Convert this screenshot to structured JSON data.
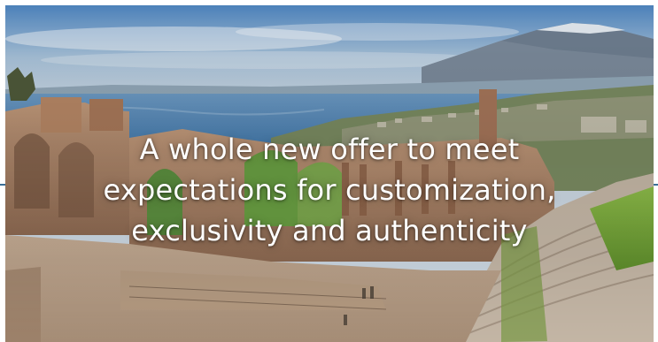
{
  "hero": {
    "image_alt": "Ancient Greek theatre of Taormina overlooking the sea and Mount Etna",
    "headline_lines": [
      "A whole new offer to meet",
      "expectations for customization,",
      "exclusivity and authenticity"
    ]
  },
  "colors": {
    "sky": "#6f9cc8",
    "sea": "#4f86b8",
    "stone": "#b58a6a",
    "grass": "#7fae3f",
    "accent_line": "#3a6f97"
  }
}
